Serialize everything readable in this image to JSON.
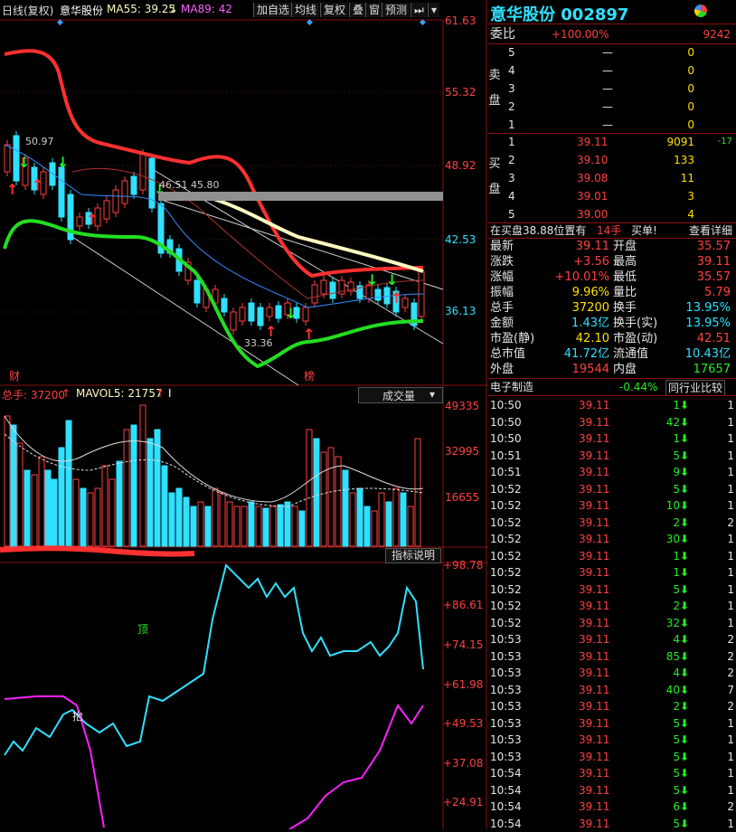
{
  "toolbar": {
    "period": "日线(复权)",
    "stock_name": "意华股份",
    "ma55": "MA55: 39.25",
    "ma89": "MA89: 42",
    "buttons": [
      "加自选",
      "均线",
      "复权",
      "叠",
      "窗",
      "预测"
    ]
  },
  "price_axis": [
    "61.63",
    "55.32",
    "48.92",
    "42.53",
    "36.13"
  ],
  "price_annotations": {
    "high": "50.97",
    "mid": "46.51 45.80",
    "low": "33.36",
    "marker_cai": "财",
    "marker_bang": "榜"
  },
  "volume_header": {
    "total": "总手: 37200",
    "mavol": "MAVOL5: 21757",
    "tick": "I",
    "dropdown": "成交量"
  },
  "volume_axis": [
    "49335",
    "32995",
    "16655"
  ],
  "indicator_button": "指标说明",
  "indicator_axis": [
    "+98.78",
    "+86.61",
    "+74.15",
    "+61.98",
    "+49.53",
    "+37.08",
    "+24.91"
  ],
  "indicator_labels": {
    "top": "顶",
    "bottom": "抬"
  },
  "colors": {
    "up": "#ff4040",
    "down": "#30e0ff",
    "accent": "#30e0ff",
    "ma_red": "#ff3030",
    "ma_green": "#22dd22",
    "ma_yellow": "#fffac0"
  },
  "quote": {
    "title": "意华股份 002897",
    "weibi_label": "委比",
    "weibi_value": "+100.00%",
    "weicha_value": "9242",
    "sell_label": "卖盘",
    "buy_label": "买盘",
    "sell": [
      {
        "level": "5",
        "price": "—",
        "vol": "0"
      },
      {
        "level": "4",
        "price": "—",
        "vol": "0"
      },
      {
        "level": "3",
        "price": "—",
        "vol": "0"
      },
      {
        "level": "2",
        "price": "—",
        "vol": "0"
      },
      {
        "level": "1",
        "price": "—",
        "vol": "0"
      }
    ],
    "buy": [
      {
        "level": "1",
        "price": "39.11",
        "vol": "9091",
        "chg": "-17"
      },
      {
        "level": "2",
        "price": "39.10",
        "vol": "133",
        "chg": ""
      },
      {
        "level": "3",
        "price": "39.08",
        "vol": "11",
        "chg": ""
      },
      {
        "level": "4",
        "price": "39.01",
        "vol": "3",
        "chg": ""
      },
      {
        "level": "5",
        "price": "39.00",
        "vol": "4",
        "chg": ""
      }
    ],
    "info_bar": {
      "text": "在买盘38.88位置有",
      "qty": "14手",
      "buy": "买单!",
      "detail": "查看详细"
    },
    "stats": [
      {
        "l1": "最新",
        "v1": "39.11",
        "l2": "开盘",
        "v2": "35.57"
      },
      {
        "l1": "涨跌",
        "v1": "+3.56",
        "l2": "最高",
        "v2": "39.11"
      },
      {
        "l1": "涨幅",
        "v1": "+10.01%",
        "l2": "最低",
        "v2": "35.57"
      },
      {
        "l1": "振幅",
        "v1": "9.96%",
        "l2": "量比",
        "v2": "5.79"
      },
      {
        "l1": "总手",
        "v1": "37200",
        "l2": "换手",
        "v2": "13.95%"
      },
      {
        "l1": "金额",
        "v1": "1.43亿",
        "l2": "换手(实)",
        "v2": "13.95%"
      },
      {
        "l1": "市盈(静)",
        "v1": "42.10",
        "l2": "市盈(动)",
        "v2": "42.51"
      },
      {
        "l1": "总市值",
        "v1": "41.72亿",
        "l2": "流通值",
        "v2": "10.43亿"
      },
      {
        "l1": "外盘",
        "v1": "19544",
        "l2": "内盘",
        "v2": "17657"
      }
    ],
    "sector": {
      "name": "电子制造",
      "pct": "-0.44%",
      "compare": "同行业比较"
    },
    "ticks": [
      {
        "t": "10:50",
        "p": "39.11",
        "v": "1",
        "n": "1"
      },
      {
        "t": "10:50",
        "p": "39.11",
        "v": "42",
        "n": "1"
      },
      {
        "t": "10:50",
        "p": "39.11",
        "v": "1",
        "n": "1"
      },
      {
        "t": "10:51",
        "p": "39.11",
        "v": "5",
        "n": "1"
      },
      {
        "t": "10:51",
        "p": "39.11",
        "v": "9",
        "n": "1"
      },
      {
        "t": "10:52",
        "p": "39.11",
        "v": "5",
        "n": "1"
      },
      {
        "t": "10:52",
        "p": "39.11",
        "v": "10",
        "n": "1"
      },
      {
        "t": "10:52",
        "p": "39.11",
        "v": "2",
        "n": "2"
      },
      {
        "t": "10:52",
        "p": "39.11",
        "v": "30",
        "n": "1"
      },
      {
        "t": "10:52",
        "p": "39.11",
        "v": "1",
        "n": "1"
      },
      {
        "t": "10:52",
        "p": "39.11",
        "v": "1",
        "n": "1"
      },
      {
        "t": "10:52",
        "p": "39.11",
        "v": "5",
        "n": "1"
      },
      {
        "t": "10:52",
        "p": "39.11",
        "v": "2",
        "n": "1"
      },
      {
        "t": "10:52",
        "p": "39.11",
        "v": "32",
        "n": "1"
      },
      {
        "t": "10:53",
        "p": "39.11",
        "v": "4",
        "n": "2"
      },
      {
        "t": "10:53",
        "p": "39.11",
        "v": "85",
        "n": "2"
      },
      {
        "t": "10:53",
        "p": "39.11",
        "v": "4",
        "n": "2"
      },
      {
        "t": "10:53",
        "p": "39.11",
        "v": "40",
        "n": "7"
      },
      {
        "t": "10:53",
        "p": "39.11",
        "v": "2",
        "n": "2"
      },
      {
        "t": "10:53",
        "p": "39.11",
        "v": "5",
        "n": "1"
      },
      {
        "t": "10:53",
        "p": "39.11",
        "v": "5",
        "n": "1"
      },
      {
        "t": "10:53",
        "p": "39.11",
        "v": "5",
        "n": "1"
      },
      {
        "t": "10:54",
        "p": "39.11",
        "v": "5",
        "n": "1"
      },
      {
        "t": "10:54",
        "p": "39.11",
        "v": "5",
        "n": "1"
      },
      {
        "t": "10:54",
        "p": "39.11",
        "v": "6",
        "n": "2"
      },
      {
        "t": "10:54",
        "p": "39.11",
        "v": "5",
        "n": "1"
      }
    ]
  }
}
